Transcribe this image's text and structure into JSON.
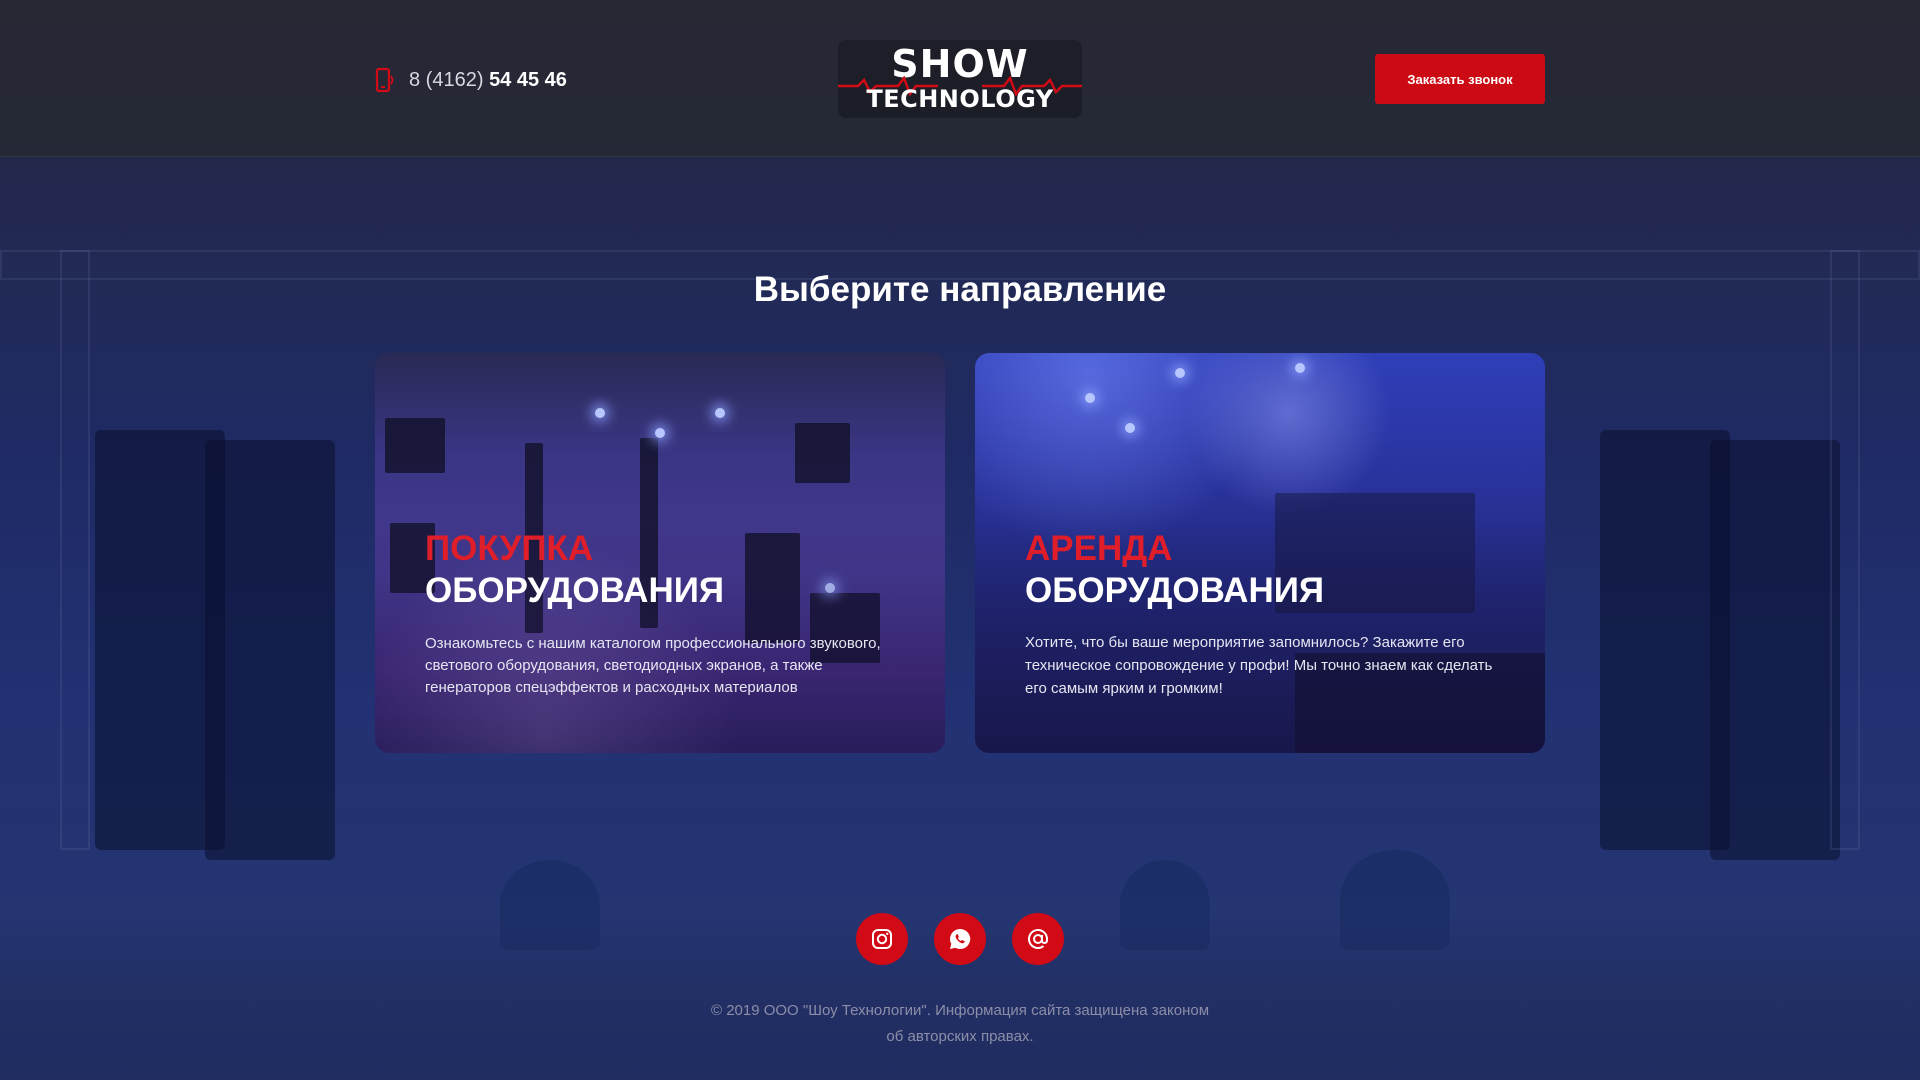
{
  "header": {
    "phone_prefix": "8 (4162)",
    "phone_main": "54 45 46",
    "logo": {
      "line1": "SHOW",
      "line2": "TECHNOLOGY"
    },
    "callback_label": "Заказать звонок"
  },
  "main": {
    "title": "Выберите направление",
    "cards": [
      {
        "accent": "ПОКУПКА",
        "heading": "ОБОРУДОВАНИЯ",
        "description": "Ознакомьтесь с нашим каталогом профессионального звукового, светового оборудования, светодиодных экранов, а также генераторов спецэффектов и расходных материалов"
      },
      {
        "accent": "АРЕНДА",
        "heading": "ОБОРУДОВАНИЯ",
        "description": "Хотите, что бы ваше мероприятие запомнилось? Закажите его техническое сопровождение у профи! Мы точно знаем как сделать его самым ярким и громким!"
      }
    ]
  },
  "social": [
    {
      "icon": "instagram-icon"
    },
    {
      "icon": "whatsapp-icon"
    },
    {
      "icon": "email-icon"
    }
  ],
  "footer": {
    "line1": "© 2019 ООО \"Шоу Технологии\". Информация сайта защищена законом",
    "line2": "об авторских правах."
  },
  "colors": {
    "accent_red": "#cc0a14",
    "header_bg": "#26283a",
    "footer_text": "#8c8ea8"
  }
}
